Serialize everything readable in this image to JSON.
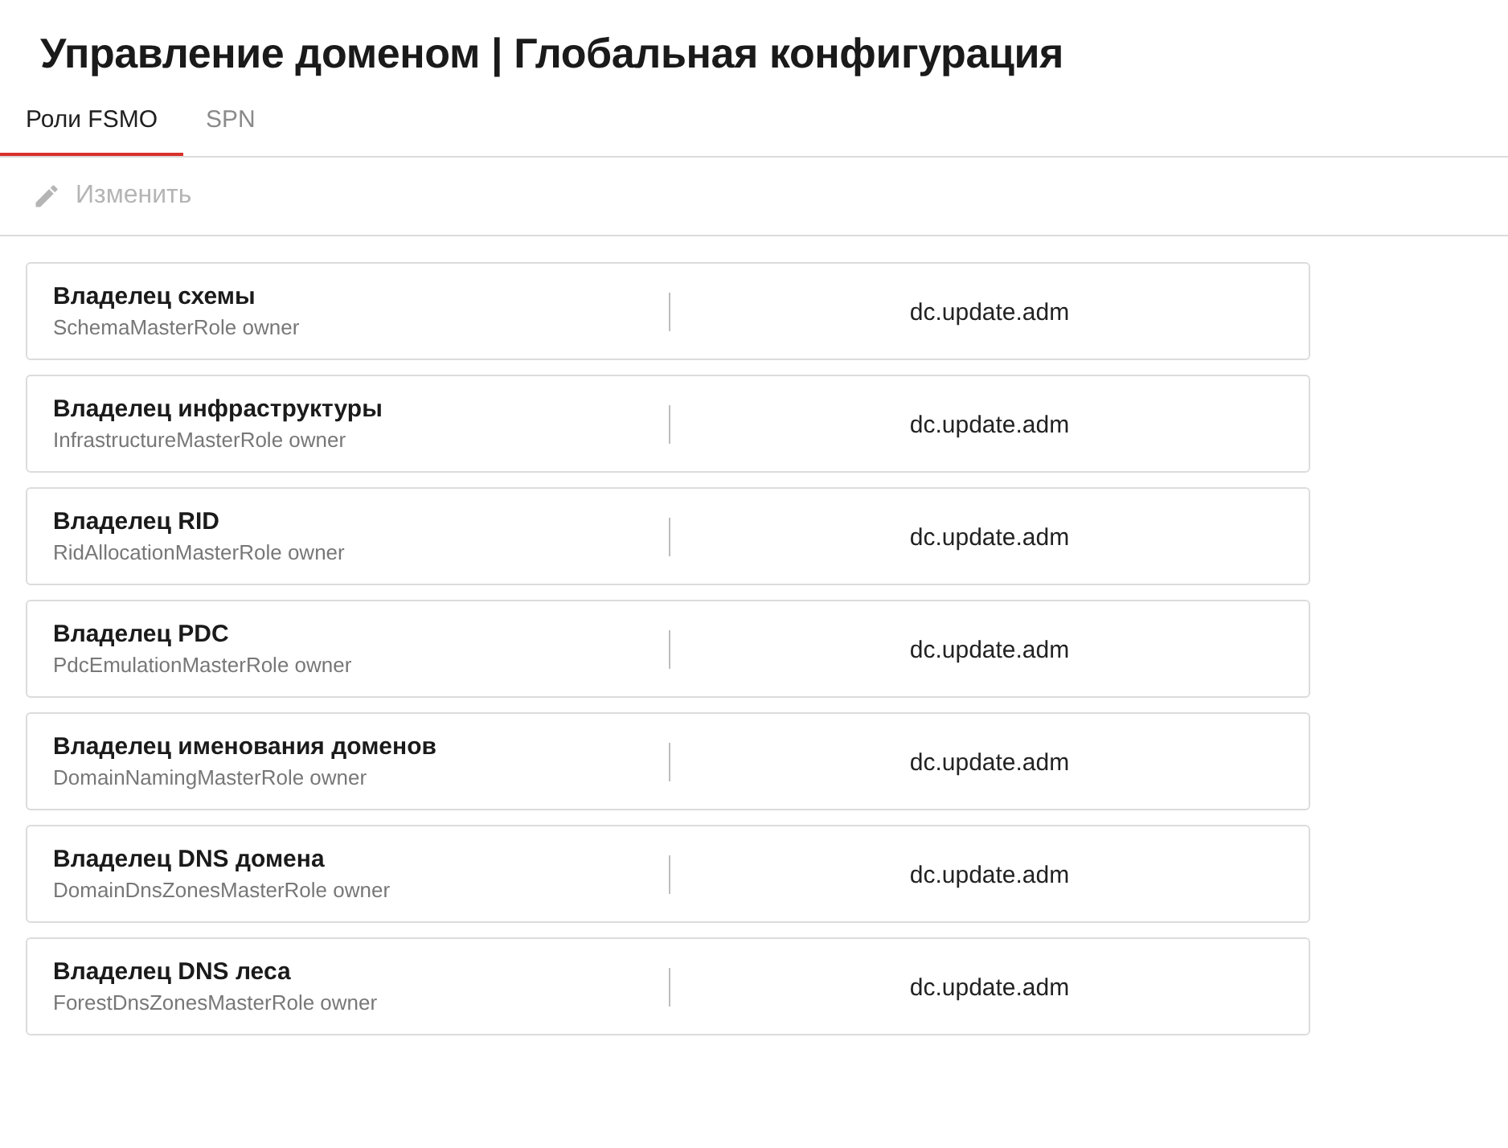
{
  "title": "Управление доменом | Глобальная конфигурация",
  "tabs": [
    {
      "label": "Роли FSMO",
      "selected": true
    },
    {
      "label": "SPN",
      "selected": false
    }
  ],
  "toolbar": {
    "edit_button": {
      "label": "Изменить",
      "disabled": true
    }
  },
  "roles": [
    {
      "name": "Владелец схемы",
      "attribute": "SchemaMasterRole owner",
      "value": "dc.update.adm"
    },
    {
      "name": "Владелец инфраструктуры",
      "attribute": "InfrastructureMasterRole owner",
      "value": "dc.update.adm"
    },
    {
      "name": "Владелец RID",
      "attribute": "RidAllocationMasterRole owner",
      "value": "dc.update.adm"
    },
    {
      "name": "Владелец PDC",
      "attribute": "PdcEmulationMasterRole owner",
      "value": "dc.update.adm"
    },
    {
      "name": "Владелец именования доменов",
      "attribute": "DomainNamingMasterRole owner",
      "value": "dc.update.adm"
    },
    {
      "name": "Владелец DNS домена",
      "attribute": "DomainDnsZonesMasterRole owner",
      "value": "dc.update.adm"
    },
    {
      "name": "Владелец DNS леса",
      "attribute": "ForestDnsZonesMasterRole owner",
      "value": "dc.update.adm"
    }
  ]
}
